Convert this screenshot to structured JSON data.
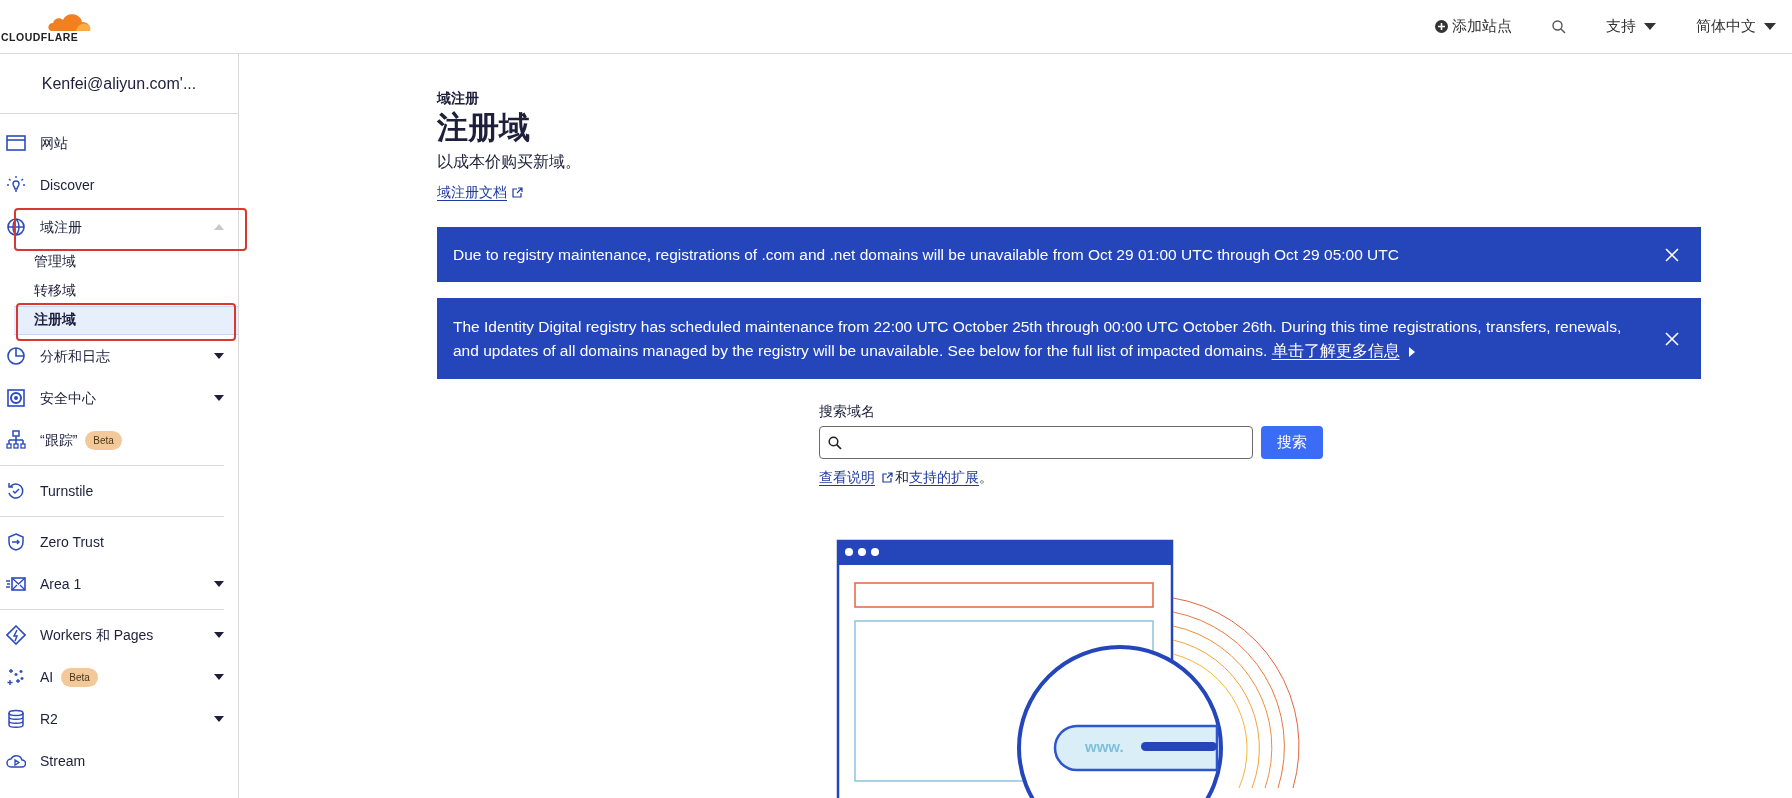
{
  "header": {
    "logo_text": "CLOUDFLARE",
    "actions": [
      {
        "kind": "add",
        "label": "添加站点"
      },
      {
        "kind": "search"
      },
      {
        "kind": "menu",
        "label": "支持"
      },
      {
        "kind": "menu",
        "label": "简体中文"
      }
    ]
  },
  "sidebar": {
    "account": "Kenfei@aliyun.com'...",
    "items": [
      {
        "kind": "item",
        "label": "网站",
        "highlighted": false
      },
      {
        "kind": "item",
        "label": "Discover",
        "highlighted": false
      },
      {
        "kind": "item",
        "label": "域注册",
        "expanded": true,
        "highlighted": true,
        "children": [
          {
            "label": "管理域",
            "selected": false,
            "highlighted": false
          },
          {
            "label": "转移域",
            "selected": false,
            "highlighted": false
          },
          {
            "label": "注册域",
            "selected": true,
            "highlighted": true
          }
        ]
      },
      {
        "kind": "item",
        "label": "分析和日志",
        "expanded": false,
        "highlighted": false
      },
      {
        "kind": "item",
        "label": "安全中心",
        "expanded": false,
        "highlighted": false
      },
      {
        "kind": "item",
        "label": "“跟踪”",
        "badge": "Beta",
        "highlighted": false
      },
      {
        "kind": "divider"
      },
      {
        "kind": "item",
        "label": "Turnstile",
        "highlighted": false
      },
      {
        "kind": "divider"
      },
      {
        "kind": "item",
        "label": "Zero Trust",
        "highlighted": false
      },
      {
        "kind": "item",
        "label": "Area 1",
        "expanded": false,
        "highlighted": false
      },
      {
        "kind": "divider"
      },
      {
        "kind": "item",
        "label": "Workers 和 Pages",
        "expanded": false,
        "highlighted": false
      },
      {
        "kind": "item",
        "label": "AI",
        "badge": "Beta",
        "expanded": false,
        "highlighted": false
      },
      {
        "kind": "item",
        "label": "R2",
        "expanded": false,
        "highlighted": false
      },
      {
        "kind": "item",
        "label": "Stream",
        "highlighted": false
      }
    ]
  },
  "main": {
    "breadcrumb": "域注册",
    "title": "注册域",
    "subtitle": "以成本价购买新域。",
    "doc_link": "域注册文档",
    "alerts": [
      {
        "text": "Due to registry maintenance, registrations of .com and .net domains will be unavailable from Oct 29 01:00 UTC through Oct 29 05:00 UTC"
      },
      {
        "text": "The Identity Digital registry has scheduled maintenance from 22:00 UTC October 25th through 00:00 UTC October 26th. During this time registrations, transfers, renewals, and updates of all domains managed by the registry will be unavailable. See below for the full list of impacted domains.",
        "link": "单击了解更多信息"
      }
    ],
    "search": {
      "label": "搜索域名",
      "button": "搜索",
      "help_link": "查看说明",
      "help_middle": "和",
      "help_link2": "支持的扩展",
      "help_end": "。"
    },
    "illustration": {
      "label": "www."
    }
  }
}
